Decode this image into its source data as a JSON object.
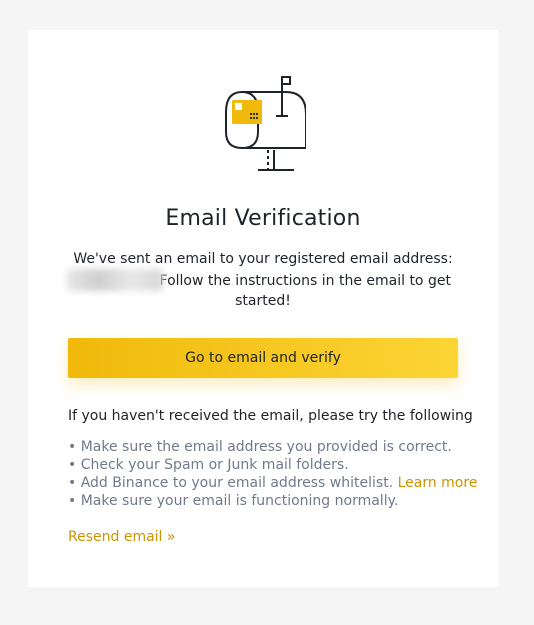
{
  "card": {
    "title": "Email Verification",
    "desc_line1": "We've sent an email to your registered email address:",
    "desc_line2": "Follow the instructions in the email to get started!",
    "cta_label": "Go to email and verify",
    "help_heading": "If you haven't received the email, please try the following",
    "tips": [
      "Make sure the email address you provided is correct.",
      "Check your Spam or Junk mail folders.",
      "Add Binance to your email address whitelist.",
      "Make sure your email is functioning normally."
    ],
    "learn_more": "Learn more",
    "resend": "Resend email »"
  },
  "colors": {
    "accent_start": "#f0b90b",
    "accent_end": "#fcd535",
    "link": "#c99400",
    "text": "#1e2329",
    "muted": "#707a8a"
  },
  "icons": {
    "illustration": "mailbox-icon"
  }
}
